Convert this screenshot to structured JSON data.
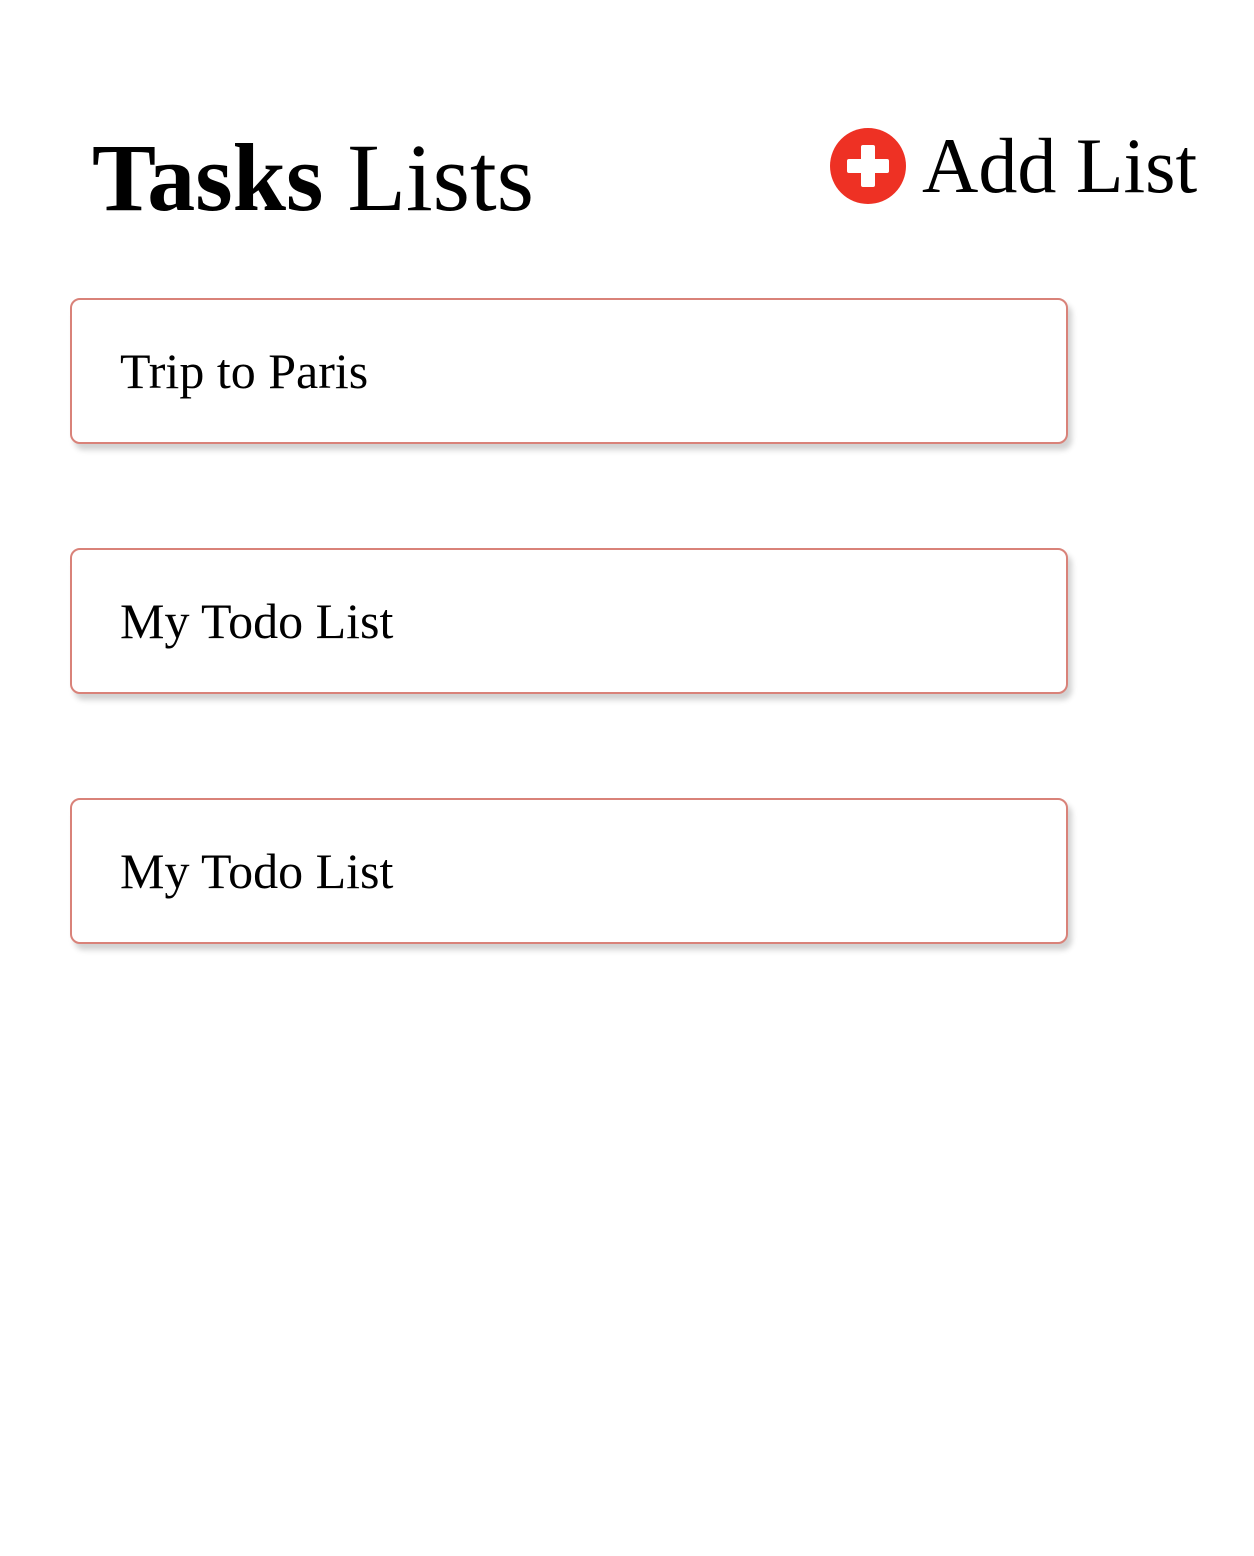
{
  "header": {
    "title_strong": "Tasks",
    "title_rest": "Lists",
    "add_button": {
      "label": "Add List",
      "icon": "plus-circle-icon"
    }
  },
  "lists": [
    {
      "title": "Trip to Paris"
    },
    {
      "title": "My Todo List"
    },
    {
      "title": "My Todo List"
    }
  ],
  "colors": {
    "accent": "#ee3124",
    "card_border": "#d98279",
    "text": "#000000",
    "background": "#ffffff"
  }
}
